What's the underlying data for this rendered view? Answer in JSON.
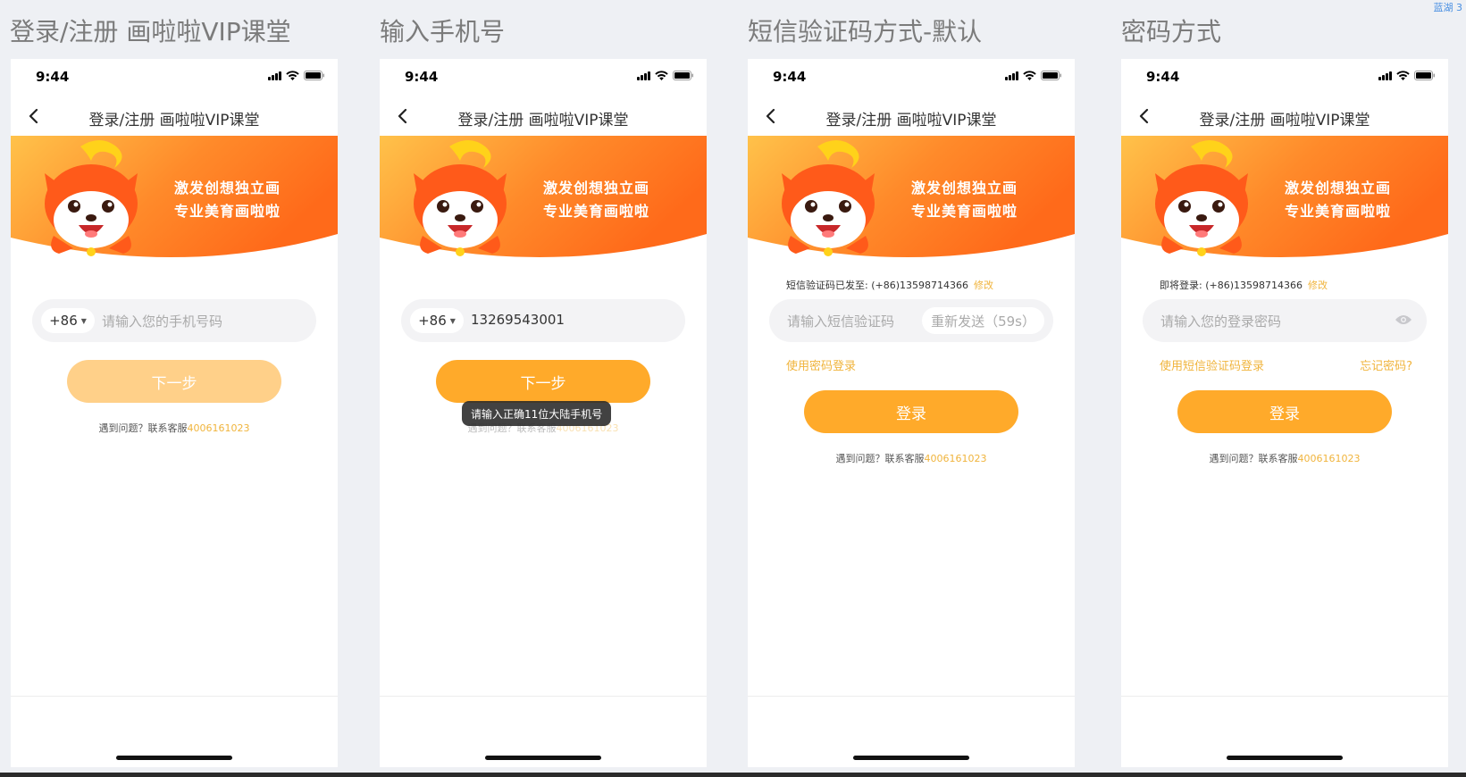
{
  "corner_note": "蓝湖 3",
  "screens": [
    {
      "section_title": "登录/注册 画啦啦VIP课堂",
      "status_time": "9:44",
      "nav_title": "登录/注册 画啦啦VIP课堂",
      "banner_line1": "激发创想独立画",
      "banner_line2": "专业美育画啦啦",
      "country_code": "+86",
      "phone_placeholder": "请输入您的手机号码",
      "next_label": "下一步",
      "help_text": "遇到问题？联系客服",
      "help_phone": "4006161023"
    },
    {
      "section_title": "输入手机号",
      "status_time": "9:44",
      "nav_title": "登录/注册 画啦啦VIP课堂",
      "banner_line1": "激发创想独立画",
      "banner_line2": "专业美育画啦啦",
      "country_code": "+86",
      "phone_value": "13269543001",
      "next_label": "下一步",
      "toast": "请输入正确11位大陆手机号",
      "help_text": "遇到问题？联系客服",
      "help_phone": "4006161023"
    },
    {
      "section_title": "短信验证码方式-默认",
      "status_time": "9:44",
      "nav_title": "登录/注册 画啦啦VIP课堂",
      "banner_line1": "激发创想独立画",
      "banner_line2": "专业美育画啦啦",
      "sent_info": "短信验证码已发至: (+86)13598714366",
      "modify_label": "修改",
      "code_placeholder": "请输入短信验证码",
      "resend_label": "重新发送（59s）",
      "switch_label": "使用密码登录",
      "login_label": "登录",
      "help_text": "遇到问题？联系客服",
      "help_phone": "4006161023"
    },
    {
      "section_title": "密码方式",
      "status_time": "9:44",
      "nav_title": "登录/注册 画啦啦VIP课堂",
      "banner_line1": "激发创想独立画",
      "banner_line2": "专业美育画啦啦",
      "login_info": "即将登录: (+86)13598714366",
      "modify_label": "修改",
      "password_placeholder": "请输入您的登录密码",
      "switch_label": "使用短信验证码登录",
      "forgot_label": "忘记密码?",
      "login_label": "登录",
      "help_text": "遇到问题？联系客服",
      "help_phone": "4006161023"
    }
  ],
  "colors": {
    "accent": "#ffaa2a",
    "accent_disabled": "#ffd089",
    "link": "#f0b43c",
    "banner_orange": "#ff6a1a",
    "banner_yellow": "#ffc24a"
  }
}
